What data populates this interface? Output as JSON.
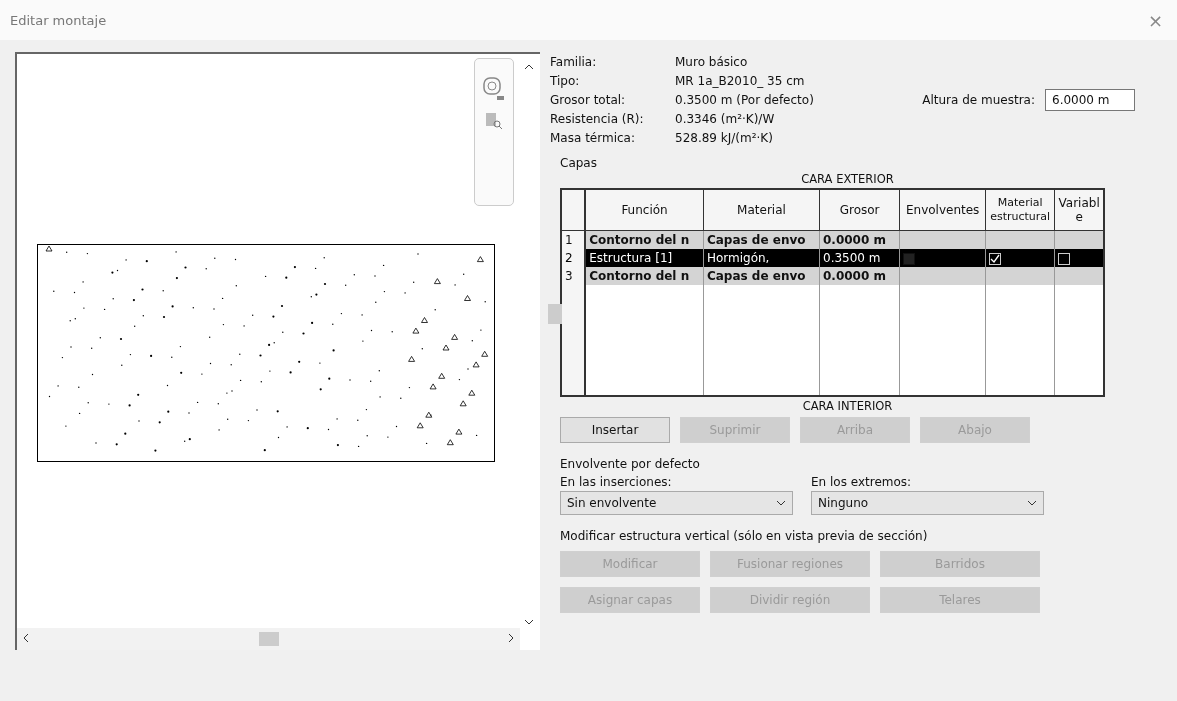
{
  "window": {
    "title": "Editar montaje",
    "close": "×"
  },
  "info": [
    {
      "label": "Familia:",
      "value": "Muro básico"
    },
    {
      "label": "Tipo:",
      "value": "MR 1a_B2010_ 35 cm"
    },
    {
      "label": "Grosor total:",
      "value": "0.3500 m (Por defecto)"
    },
    {
      "label": "Resistencia (R):",
      "value": "0.3346 (m²·K)/W"
    },
    {
      "label": "Masa térmica:",
      "value": "528.89 kJ/(m²·K)"
    }
  ],
  "sample_height": {
    "label": "Altura de muestra:",
    "value": "6.0000 m"
  },
  "layers": {
    "title": "Capas",
    "top_caption": "CARA EXTERIOR",
    "bottom_caption": "CARA INTERIOR",
    "columns": [
      "Función",
      "Material",
      "Grosor",
      "Envolventes",
      "Material estructural",
      "Variabl e"
    ],
    "rows": [
      {
        "kind": "boundary",
        "selected": false,
        "number": "1",
        "function": "Contorno del n",
        "material": "Capas de envo",
        "thickness": "0.0000 m"
      },
      {
        "kind": "layer",
        "selected": true,
        "number": "2",
        "function": "Estructura [1]",
        "material": "Hormigón,",
        "thickness": "0.3500 m",
        "wraps": false,
        "structural": true,
        "variable": false
      },
      {
        "kind": "boundary",
        "selected": false,
        "number": "3",
        "function": "Contorno del n",
        "material": "Capas de envo",
        "thickness": "0.0000 m"
      }
    ],
    "buttons": [
      {
        "label": "Insertar",
        "disabled": false
      },
      {
        "label": "Suprimir",
        "disabled": true
      },
      {
        "label": "Arriba",
        "disabled": true
      },
      {
        "label": "Abajo",
        "disabled": true
      }
    ]
  },
  "default_wrapping": {
    "title": "Envolvente por defecto",
    "fields": [
      {
        "label": "En las inserciones:",
        "value": "Sin envolvente"
      },
      {
        "label": "En los extremos:",
        "value": "Ninguno"
      }
    ]
  },
  "vertical": {
    "title": "Modificar estructura vertical (sólo en vista previa de sección)",
    "buttons": [
      {
        "label": "Modificar",
        "disabled": true
      },
      {
        "label": "Fusionar regiones",
        "disabled": true
      },
      {
        "label": "Barridos",
        "disabled": true
      },
      {
        "label": "Asignar capas",
        "disabled": true
      },
      {
        "label": "Dividir región",
        "disabled": true
      },
      {
        "label": "Telares",
        "disabled": true
      }
    ]
  }
}
